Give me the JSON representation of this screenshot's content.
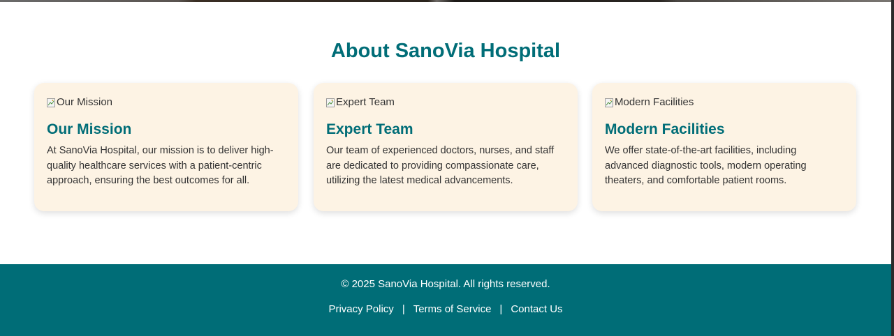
{
  "about": {
    "title": "About SanoVia Hospital",
    "cards": [
      {
        "image_alt": "Our Mission",
        "title": "Our Mission",
        "text": "At SanoVia Hospital, our mission is to deliver high-quality healthcare services with a patient-centric approach, ensuring the best outcomes for all."
      },
      {
        "image_alt": "Expert Team",
        "title": "Expert Team",
        "text": "Our team of experienced doctors, nurses, and staff are dedicated to providing compassionate care, utilizing the latest medical advancements."
      },
      {
        "image_alt": "Modern Facilities",
        "title": "Modern Facilities",
        "text": "We offer state-of-the-art facilities, including advanced diagnostic tools, modern operating theaters, and comfortable patient rooms."
      }
    ]
  },
  "footer": {
    "copyright": "© 2025 SanoVia Hospital. All rights reserved.",
    "links": {
      "privacy": "Privacy Policy",
      "terms": "Terms of Service",
      "contact": "Contact Us"
    },
    "separator": "|"
  },
  "colors": {
    "brand": "#006d77",
    "card_background": "#fdf3e4",
    "body_text": "#333333",
    "footer_text": "#ffffff"
  },
  "icons": {
    "image_placeholder": "broken-image-icon"
  }
}
